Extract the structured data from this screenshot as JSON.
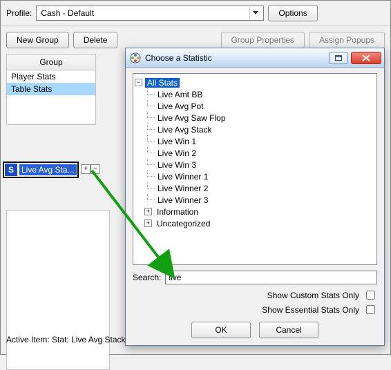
{
  "topbar": {
    "profile_label": "Profile:",
    "profile_value": "Cash - Default",
    "options_label": "Options"
  },
  "buttons": {
    "new_group": "New Group",
    "delete": "Delete",
    "group_properties": "Group Properties",
    "assign_popups": "Assign Popups"
  },
  "group_panel": {
    "header": "Group",
    "items": [
      "Player Stats",
      "Table Stats"
    ],
    "selected_index": 1
  },
  "selected_stat": {
    "badge": "S",
    "label": "Live Avg Sta...",
    "plus_tip": "Add",
    "minus_tip": "Remove"
  },
  "active_item_line": "Active Item: Stat: Live Avg Stack",
  "dialog": {
    "title": "Choose a Statistic",
    "tree": {
      "root_label": "All Stats",
      "root_expanded": true,
      "leaves": [
        "Live Amt BB",
        "Live Avg Pot",
        "Live Avg Saw Flop",
        "Live Avg Stack",
        "Live Win 1",
        "Live Win 2",
        "Live Win 3",
        "Live Winner 1",
        "Live Winner 2",
        "Live Winner 3"
      ],
      "collapsed_nodes": [
        "Information",
        "Uncategorized"
      ]
    },
    "search_label": "Search:",
    "search_value": "live",
    "check_custom": "Show Custom Stats Only",
    "check_essential": "Show Essential Stats Only",
    "ok_label": "OK",
    "cancel_label": "Cancel"
  }
}
